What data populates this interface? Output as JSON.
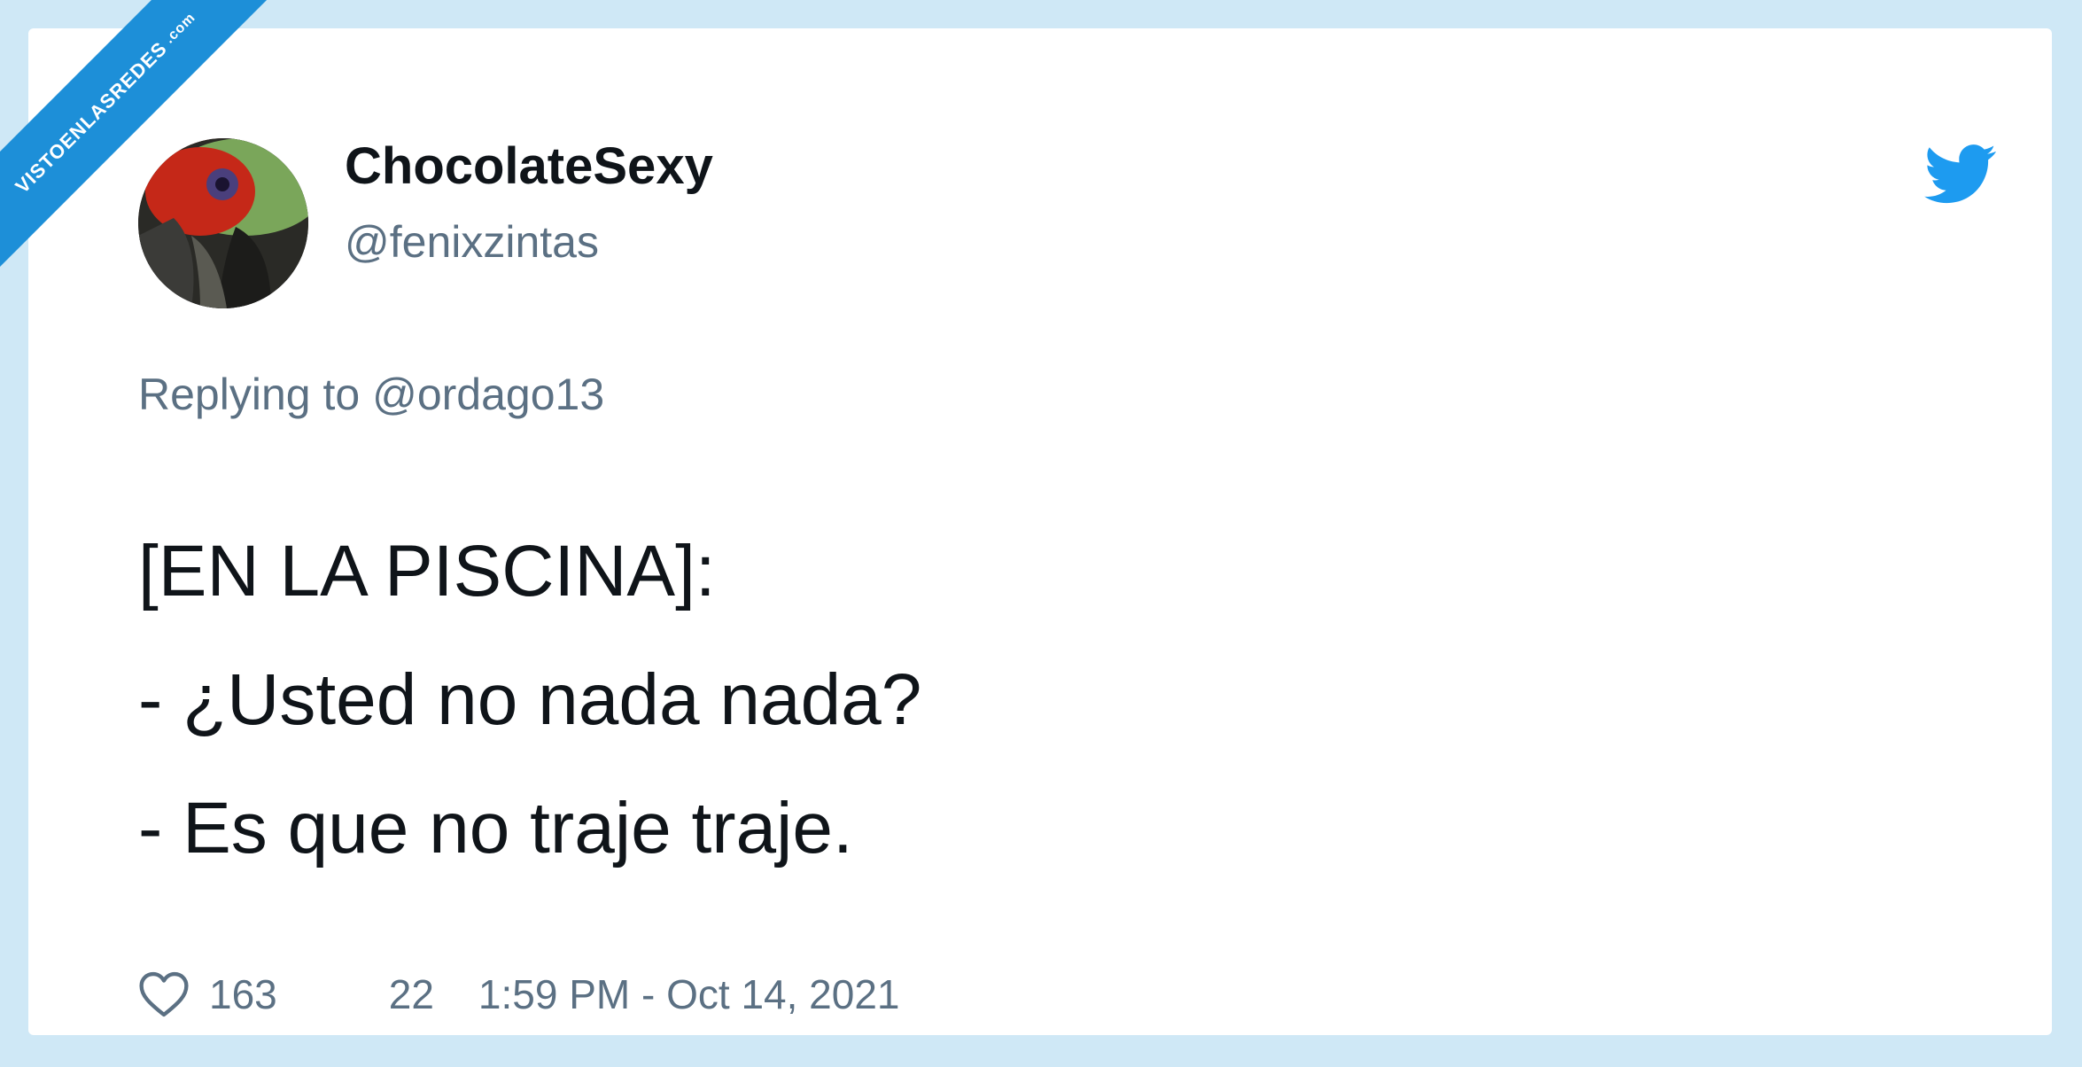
{
  "watermark": {
    "main": "VISTOENLASREDES",
    "domain": ".com"
  },
  "tweet": {
    "author_name": "ChocolateSexy",
    "author_handle": "@fenixzintas",
    "reply_prefix": "Replying to",
    "reply_to": "@ordago13",
    "text_lines": [
      "[EN LA PISCINA]:",
      "- ¿Usted no nada nada?",
      "- Es que no traje traje."
    ],
    "likes": "163",
    "replies": "22",
    "timestamp": "1:59 PM - Oct 14, 2021"
  },
  "icons": {
    "twitter": "twitter-bird-icon",
    "like": "heart-icon"
  },
  "colors": {
    "background": "#cfe8f6",
    "card": "#ffffff",
    "text_primary": "#0f1419",
    "text_secondary": "#5b7083",
    "twitter_blue": "#1d9bf0",
    "watermark": "#1d8fd8"
  }
}
